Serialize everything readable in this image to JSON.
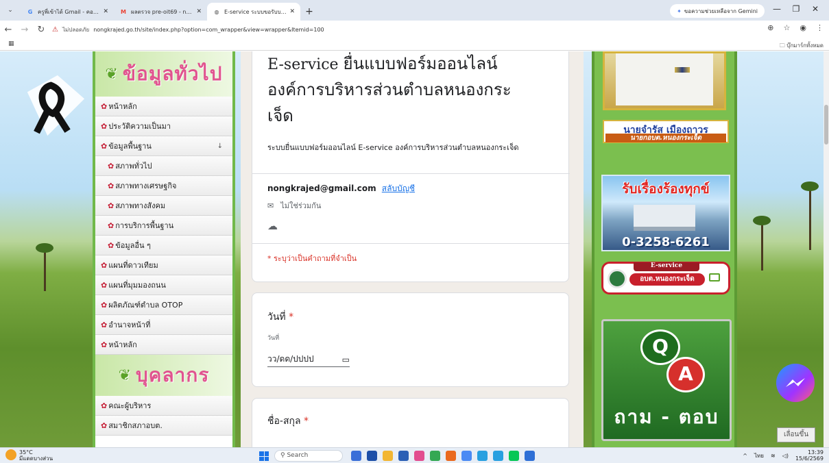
{
  "browser": {
    "tabs": [
      {
        "title": "ครูพี่เข้าได้ Gmail - คอมพิวเตอร์ -",
        "active": false,
        "icon": "google-icon",
        "color": "#4285f4"
      },
      {
        "title": "ผลตรวจ pre-oit69 - nongkrajed",
        "active": false,
        "icon": "gmail-icon",
        "color": "#ea4335"
      },
      {
        "title": "E-service ระบบขอรับบริการออนไลน์",
        "active": true,
        "icon": "site-favicon",
        "color": "#555555"
      }
    ],
    "new_tab": "+",
    "gemini": "ขอความช่วยเหลือจาก Gemini",
    "not_secure": "ไม่ปลอดภัย",
    "url": "nongkrajed.go.th/site/index.php?option=com_wrapper&view=wrapper&Itemid=100",
    "bookmarks_all": "บุ๊กมาร์กทั้งหมด"
  },
  "menu": {
    "header1": "ข้อมูลทั่วไป",
    "items1": [
      {
        "label": "หน้าหลัก",
        "sub": false
      },
      {
        "label": "ประวัติความเป็นมา",
        "sub": false
      },
      {
        "label": "ข้อมูลพื้นฐาน",
        "sub": false,
        "arrow": "↓"
      },
      {
        "label": "สภาพทั่วไป",
        "sub": true
      },
      {
        "label": "สภาพทางเศรษฐกิจ",
        "sub": true
      },
      {
        "label": "สภาพทางสังคม",
        "sub": true
      },
      {
        "label": "การบริการพื้นฐาน",
        "sub": true
      },
      {
        "label": "ข้อมูลอื่น ๆ",
        "sub": true
      },
      {
        "label": "แผนที่ดาวเทียม",
        "sub": false
      },
      {
        "label": "แผนที่มุมมองถนน",
        "sub": false
      },
      {
        "label": "ผลิตภัณฑ์ตำบล OTOP",
        "sub": false
      },
      {
        "label": "อำนาจหน้าที่",
        "sub": false
      },
      {
        "label": "หน้าหลัก",
        "sub": false
      }
    ],
    "header2": "บุคลากร",
    "items2": [
      {
        "label": "คณะผู้บริหาร",
        "sub": false
      },
      {
        "label": "สมาชิกสภาอบต.",
        "sub": false
      }
    ]
  },
  "form": {
    "title_latin": "E-service",
    "title_thai_1": "ยื่นแบบฟอร์มออนไลน์",
    "title_thai_2": "องค์การบริหารส่วนตำบลหนองกระ",
    "title_thai_3": "เจ็ด",
    "description": "ระบบยื่นแบบฟอร์มออนไลน์ E-service องค์การบริหารส่วนตำบลหนองกระเจ็ด",
    "email": "nongkrajed@gmail.com",
    "switch_account": "สลับบัญชี",
    "not_shared": "ไม่ใช่ร่วมกัน",
    "required_note": "* ระบุว่าเป็นคำถามที่จำเป็น",
    "q_date": {
      "label": "วันที่",
      "sublabel": "วันที่",
      "placeholder": "วว/ดด/ปปปป"
    },
    "q_name": {
      "label": "ชื่อ-สกุล"
    },
    "required_star": "*"
  },
  "right": {
    "mayor_name": "นายจำรัส เมืองถาวร",
    "mayor_title": "นายกอบต.หนองกระเจ็ด",
    "complaint_heading": "รับเรื่องร้องทุกข์",
    "complaint_phone": "0-3258-6261",
    "eservice_top": "E-service",
    "eservice_org": "อบต.หนองกระเจ็ด",
    "qa_q": "Q",
    "qa_a": "A",
    "qa_label": "ถาม - ตอบ",
    "back_to_top": "เลื่อนขึ้น"
  },
  "taskbar": {
    "temp": "35°C",
    "weather": "มีแดดบางส่วน",
    "search": "Search",
    "lang": "ไทย",
    "time": "13:39",
    "date": "15/6/2569"
  }
}
